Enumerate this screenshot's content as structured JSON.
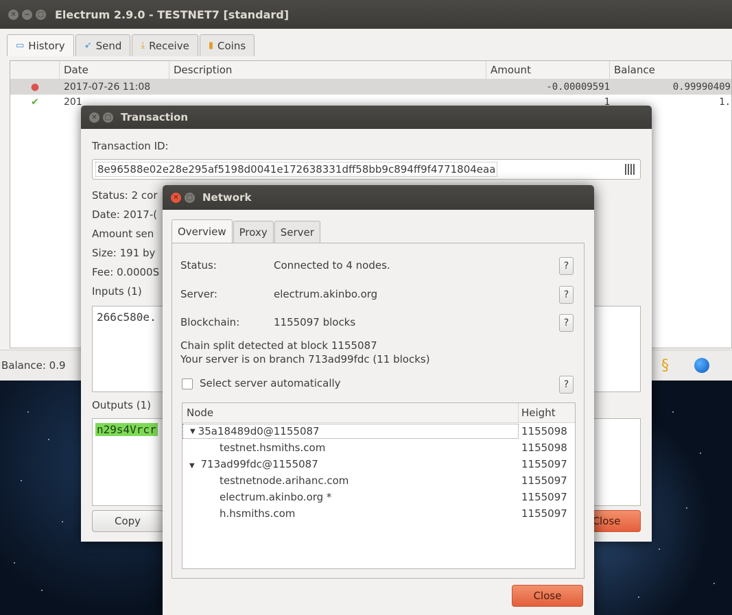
{
  "main_window": {
    "title": "Electrum 2.9.0  -  TESTNET7  [standard]",
    "tabs": [
      {
        "label": "History",
        "icon": "history-icon"
      },
      {
        "label": "Send",
        "icon": "send-icon"
      },
      {
        "label": "Receive",
        "icon": "receive-icon"
      },
      {
        "label": "Coins",
        "icon": "coins-icon"
      }
    ],
    "history": {
      "columns": [
        "Date",
        "Description",
        "Amount",
        "Balance"
      ],
      "rows": [
        {
          "date": "2017-07-26 11:08",
          "description": "",
          "amount": "-0.00009591",
          "balance": "0.99990409"
        },
        {
          "date": "201",
          "description": "",
          "amount": "1",
          "balance": "1."
        }
      ]
    },
    "status": {
      "balance_label": "Balance: 0.9"
    }
  },
  "transaction_dialog": {
    "title": "Transaction",
    "txid_label": "Transaction ID:",
    "txid": "8e96588e02e28e295af5198d0041e172638331dff58bb9c894ff9f4771804eaa",
    "status": "Status: 2 cor",
    "date": "Date: 2017-(",
    "amount_sent": "Amount sen",
    "size": "Size: 191 by",
    "fee": "Fee: 0.0000S",
    "inputs_label": "Inputs (1)",
    "input_value": "266c580e.",
    "outputs_label": "Outputs (1)",
    "output_value": "n29s4Vrcr",
    "copy_label": "Copy",
    "close_label": "Close"
  },
  "network_dialog": {
    "title": "Network",
    "tabs": [
      "Overview",
      "Proxy",
      "Server"
    ],
    "status_label": "Status:",
    "status_value": "Connected to 4 nodes.",
    "server_label": "Server:",
    "server_value": "electrum.akinbo.org",
    "blockchain_label": "Blockchain:",
    "blockchain_value": "1155097 blocks",
    "split_line1": "Chain split detected at block 1155087",
    "split_line2": "Your server is on branch 713ad99fdc (11 blocks)",
    "auto_select_label": "Select server automatically",
    "help_label": "?",
    "tree_headers": [
      "Node",
      "Height"
    ],
    "branches": [
      {
        "name": "35a18489d0@1155087",
        "height": "1155098",
        "servers": [
          {
            "name": "testnet.hsmiths.com",
            "height": "1155098"
          }
        ]
      },
      {
        "name": "713ad99fdc@1155087",
        "height": "1155097",
        "servers": [
          {
            "name": "testnetnode.arihanc.com",
            "height": "1155097"
          },
          {
            "name": "electrum.akinbo.org *",
            "height": "1155097"
          },
          {
            "name": "h.hsmiths.com",
            "height": "1155097"
          }
        ]
      }
    ],
    "close_label": "Close"
  },
  "colors": {
    "accent_orange": "#e3603c",
    "output_green": "#7ed957",
    "titlebar": "#3c3b37"
  }
}
